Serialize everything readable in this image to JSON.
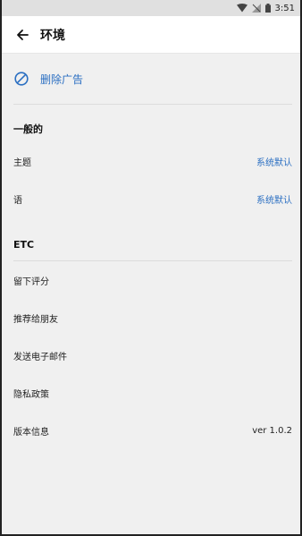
{
  "status_bar": {
    "time": "3:51"
  },
  "app_bar": {
    "title": "环境"
  },
  "remove_ads": {
    "label": "删除广告"
  },
  "sections": {
    "general": {
      "header": "一般的",
      "theme": {
        "label": "主题",
        "value": "系统默认"
      },
      "language": {
        "label": "语",
        "value": "系统默认"
      }
    },
    "etc": {
      "header": "ETC",
      "rate": {
        "label": "留下评分"
      },
      "recommend": {
        "label": "推荐给朋友"
      },
      "email": {
        "label": "发送电子邮件"
      },
      "privacy": {
        "label": "隐私政策"
      },
      "version": {
        "label": "版本信息",
        "value": "ver 1.0.2"
      }
    }
  },
  "colors": {
    "accent": "#2b6fc2",
    "background": "#f0f0f0"
  }
}
